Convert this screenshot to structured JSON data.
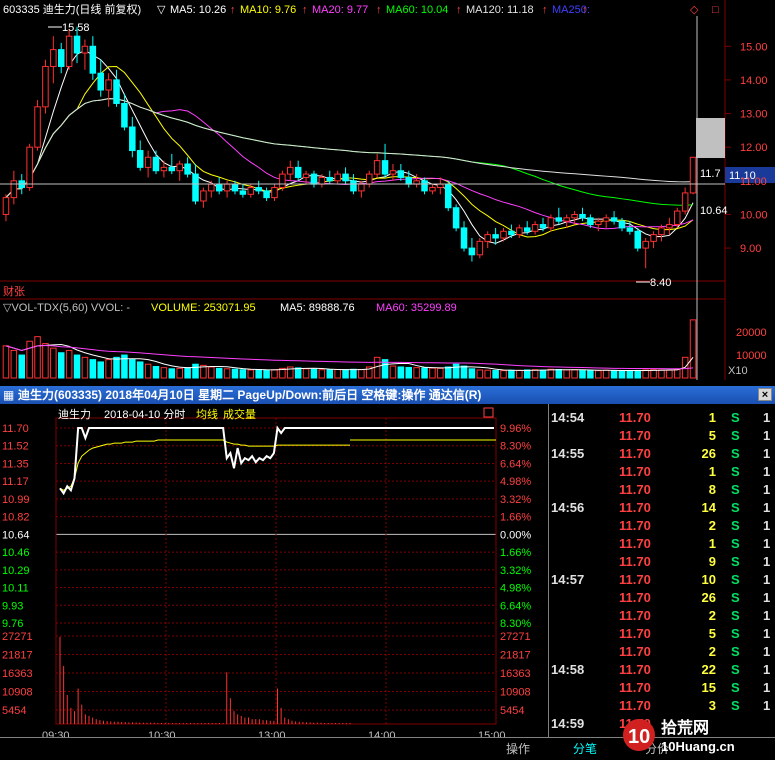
{
  "kline": {
    "title": "603335 迪生力(日线 前复权)",
    "ma_legend": [
      {
        "label": "MA5: 10.26",
        "color": "#ffffff"
      },
      {
        "label": "MA10: 9.76",
        "color": "#ffff00"
      },
      {
        "label": "MA20: 9.77",
        "color": "#ff40ff"
      },
      {
        "label": "MA60: 10.04",
        "color": "#00ff00"
      },
      {
        "label": "MA120: 11.18",
        "color": "#e0e0e0"
      },
      {
        "label": "MA250:",
        "color": "#4040ff"
      }
    ],
    "price_ticks": [
      "15.00",
      "14.00",
      "13.00",
      "12.00",
      "11.00",
      "10.00",
      "9.00"
    ],
    "current_price_box": "11.10",
    "annotations": {
      "high": "15.58",
      "low": "8.40",
      "right_a": "11.7",
      "right_b": "10.64"
    },
    "caizhang": "财张"
  },
  "volume": {
    "legend": "▽VOL-TDX(5,60)  VVOL: -",
    "volume_label": "VOLUME: 253071.95",
    "ma5_label": "MA5: 89888.76",
    "ma60_label": "MA60: 35299.89",
    "ticks": [
      "20000",
      "10000"
    ],
    "unit": "X10"
  },
  "popup": {
    "title": "迪生力(603335) 2018年04月10日 星期二 PageUp/Down:前后日 空格键:操作 通达信(R)",
    "close": "×",
    "chart_title": "迪生力",
    "chart_date": "2018-04-10 分时",
    "legend_avg": "均线",
    "legend_vol": "成交量",
    "price_left": [
      "11.70",
      "11.52",
      "11.35",
      "11.17",
      "10.99",
      "10.82",
      "10.64",
      "10.46",
      "10.29",
      "10.11",
      "9.93",
      "9.76"
    ],
    "pct_right": [
      "9.96%",
      "8.30%",
      "6.64%",
      "4.98%",
      "3.32%",
      "1.66%",
      "0.00%",
      "1.66%",
      "3.32%",
      "4.98%",
      "6.64%",
      "8.30%"
    ],
    "vol_left": [
      "27271",
      "21817",
      "16363",
      "10908",
      "5454"
    ],
    "vol_right": [
      "27271",
      "21817",
      "16363",
      "10908",
      "5454"
    ],
    "time_axis": [
      "09:30",
      "10:30",
      "13:00",
      "14:00",
      "15:00"
    ],
    "colors": {
      "up": "#ff3030",
      "down": "#00ffff",
      "flat": "#ffffff"
    }
  },
  "trades": [
    {
      "time": "14:54",
      "price": "11.70",
      "vol": "1",
      "side": "S",
      "n": "1"
    },
    {
      "time": "",
      "price": "11.70",
      "vol": "5",
      "side": "S",
      "n": "1"
    },
    {
      "time": "14:55",
      "price": "11.70",
      "vol": "26",
      "side": "S",
      "n": "1"
    },
    {
      "time": "",
      "price": "11.70",
      "vol": "1",
      "side": "S",
      "n": "1"
    },
    {
      "time": "",
      "price": "11.70",
      "vol": "8",
      "side": "S",
      "n": "1"
    },
    {
      "time": "14:56",
      "price": "11.70",
      "vol": "14",
      "side": "S",
      "n": "1"
    },
    {
      "time": "",
      "price": "11.70",
      "vol": "2",
      "side": "S",
      "n": "1"
    },
    {
      "time": "",
      "price": "11.70",
      "vol": "1",
      "side": "S",
      "n": "1"
    },
    {
      "time": "",
      "price": "11.70",
      "vol": "9",
      "side": "S",
      "n": "1"
    },
    {
      "time": "14:57",
      "price": "11.70",
      "vol": "10",
      "side": "S",
      "n": "1"
    },
    {
      "time": "",
      "price": "11.70",
      "vol": "26",
      "side": "S",
      "n": "1"
    },
    {
      "time": "",
      "price": "11.70",
      "vol": "2",
      "side": "S",
      "n": "1"
    },
    {
      "time": "",
      "price": "11.70",
      "vol": "5",
      "side": "S",
      "n": "1"
    },
    {
      "time": "",
      "price": "11.70",
      "vol": "2",
      "side": "S",
      "n": "1"
    },
    {
      "time": "14:58",
      "price": "11.70",
      "vol": "22",
      "side": "S",
      "n": "1"
    },
    {
      "time": "",
      "price": "11.70",
      "vol": "15",
      "side": "S",
      "n": "1"
    },
    {
      "time": "",
      "price": "11.70",
      "vol": "3",
      "side": "S",
      "n": "1"
    },
    {
      "time": "14:59",
      "price": "11.70",
      "vol": "",
      "side": "",
      "n": ""
    }
  ],
  "tabs": {
    "ops": "操作",
    "fenbi": "分笔",
    "fenjia": "分价"
  },
  "watermark": {
    "big": "拾荒网",
    "small": "10Huang.cn"
  },
  "chart_data": [
    {
      "type": "candlestick",
      "title": "603335 迪生力(日线 前复权)",
      "ylim": [
        8.2,
        15.9
      ],
      "annotations": {
        "high": 15.58,
        "low": 8.4
      },
      "candles": [
        [
          10.0,
          10.6,
          9.8,
          10.5
        ],
        [
          10.5,
          11.3,
          10.3,
          11.0
        ],
        [
          11.0,
          11.2,
          10.6,
          10.8
        ],
        [
          10.8,
          12.1,
          10.7,
          12.0
        ],
        [
          12.0,
          13.4,
          11.9,
          13.2
        ],
        [
          13.2,
          14.6,
          13.0,
          14.4
        ],
        [
          14.4,
          15.3,
          13.9,
          14.9
        ],
        [
          14.9,
          15.1,
          14.2,
          14.4
        ],
        [
          14.4,
          15.5,
          14.3,
          15.3
        ],
        [
          15.3,
          15.58,
          14.5,
          14.8
        ],
        [
          14.8,
          15.2,
          14.3,
          15.0
        ],
        [
          15.0,
          15.3,
          14.0,
          14.2
        ],
        [
          14.2,
          14.6,
          13.5,
          13.7
        ],
        [
          13.7,
          14.2,
          13.2,
          14.0
        ],
        [
          14.0,
          14.3,
          13.2,
          13.3
        ],
        [
          13.3,
          13.6,
          12.5,
          12.6
        ],
        [
          12.6,
          12.9,
          11.7,
          11.9
        ],
        [
          11.9,
          12.2,
          11.3,
          11.4
        ],
        [
          11.4,
          11.9,
          11.1,
          11.7
        ],
        [
          11.7,
          11.9,
          11.2,
          11.3
        ],
        [
          11.3,
          11.6,
          11.1,
          11.4
        ],
        [
          11.4,
          11.8,
          11.2,
          11.3
        ],
        [
          11.3,
          11.6,
          11.0,
          11.5
        ],
        [
          11.5,
          11.7,
          11.1,
          11.2
        ],
        [
          11.2,
          11.5,
          10.3,
          10.4
        ],
        [
          10.4,
          10.8,
          10.2,
          10.7
        ],
        [
          10.7,
          11.0,
          10.5,
          10.9
        ],
        [
          10.9,
          11.1,
          10.6,
          10.7
        ],
        [
          10.7,
          11.0,
          10.5,
          10.9
        ],
        [
          10.9,
          11.0,
          10.6,
          10.7
        ],
        [
          10.7,
          10.9,
          10.5,
          10.6
        ],
        [
          10.6,
          10.9,
          10.5,
          10.8
        ],
        [
          10.8,
          11.0,
          10.6,
          10.7
        ],
        [
          10.7,
          10.8,
          10.4,
          10.5
        ],
        [
          10.5,
          10.9,
          10.4,
          10.8
        ],
        [
          10.8,
          11.3,
          10.7,
          11.2
        ],
        [
          11.2,
          11.6,
          11.0,
          11.4
        ],
        [
          11.4,
          11.6,
          11.0,
          11.1
        ],
        [
          11.1,
          11.3,
          10.9,
          11.2
        ],
        [
          11.2,
          11.3,
          10.8,
          10.9
        ],
        [
          10.9,
          11.2,
          10.8,
          11.1
        ],
        [
          11.1,
          11.3,
          10.9,
          11.0
        ],
        [
          11.0,
          11.3,
          10.9,
          11.2
        ],
        [
          11.2,
          11.4,
          10.9,
          11.0
        ],
        [
          11.0,
          11.2,
          10.6,
          10.7
        ],
        [
          10.7,
          11.0,
          10.5,
          10.9
        ],
        [
          10.9,
          11.3,
          10.8,
          11.2
        ],
        [
          11.2,
          11.8,
          11.1,
          11.6
        ],
        [
          11.6,
          12.1,
          11.1,
          11.2
        ],
        [
          11.2,
          11.5,
          11.0,
          11.3
        ],
        [
          11.3,
          11.5,
          11.0,
          11.1
        ],
        [
          11.1,
          11.3,
          10.8,
          10.9
        ],
        [
          10.9,
          11.2,
          10.8,
          11.0
        ],
        [
          11.0,
          11.1,
          10.6,
          10.7
        ],
        [
          10.7,
          10.9,
          10.6,
          10.8
        ],
        [
          10.8,
          11.1,
          10.6,
          10.9
        ],
        [
          10.9,
          11.0,
          10.1,
          10.2
        ],
        [
          10.2,
          10.3,
          9.5,
          9.6
        ],
        [
          9.6,
          9.8,
          8.9,
          9.0
        ],
        [
          9.0,
          9.3,
          8.6,
          8.8
        ],
        [
          8.8,
          9.3,
          8.7,
          9.2
        ],
        [
          9.2,
          9.5,
          9.0,
          9.4
        ],
        [
          9.4,
          9.6,
          9.1,
          9.3
        ],
        [
          9.3,
          9.6,
          9.2,
          9.5
        ],
        [
          9.5,
          9.7,
          9.3,
          9.4
        ],
        [
          9.4,
          9.7,
          9.3,
          9.6
        ],
        [
          9.6,
          9.8,
          9.4,
          9.5
        ],
        [
          9.5,
          9.8,
          9.4,
          9.7
        ],
        [
          9.7,
          9.9,
          9.5,
          9.6
        ],
        [
          9.6,
          10.0,
          9.5,
          9.9
        ],
        [
          9.9,
          10.2,
          9.7,
          9.8
        ],
        [
          9.8,
          10.0,
          9.6,
          9.9
        ],
        [
          9.9,
          10.1,
          9.7,
          10.0
        ],
        [
          10.0,
          10.2,
          9.8,
          9.9
        ],
        [
          9.9,
          10.0,
          9.6,
          9.7
        ],
        [
          9.7,
          9.9,
          9.5,
          9.8
        ],
        [
          9.8,
          10.0,
          9.6,
          9.9
        ],
        [
          9.9,
          10.1,
          9.7,
          9.8
        ],
        [
          9.8,
          9.9,
          9.5,
          9.6
        ],
        [
          9.6,
          9.8,
          9.4,
          9.5
        ],
        [
          9.5,
          9.6,
          8.9,
          9.0
        ],
        [
          9.0,
          9.3,
          8.4,
          9.2
        ],
        [
          9.2,
          9.5,
          9.0,
          9.4
        ],
        [
          9.4,
          9.7,
          9.2,
          9.6
        ],
        [
          9.6,
          9.9,
          9.4,
          9.7
        ],
        [
          9.7,
          10.2,
          9.6,
          10.1
        ],
        [
          10.1,
          10.8,
          10.0,
          10.64
        ],
        [
          10.64,
          11.7,
          10.6,
          11.7
        ]
      ]
    },
    {
      "type": "bar",
      "title": "VOL-TDX(5,60)",
      "ylim": [
        0,
        27000
      ],
      "values": [
        14000,
        12000,
        10000,
        16000,
        18000,
        15000,
        13000,
        11000,
        12000,
        10000,
        9000,
        8000,
        7000,
        8000,
        9000,
        10000,
        8000,
        7000,
        6000,
        5000,
        4500,
        4000,
        4200,
        4500,
        6000,
        5500,
        4800,
        4200,
        4000,
        3800,
        3600,
        3500,
        3700,
        3400,
        3600,
        4200,
        4800,
        4400,
        4000,
        3800,
        3600,
        3500,
        3700,
        3600,
        3800,
        3700,
        4800,
        9000,
        8000,
        5200,
        4800,
        4600,
        4500,
        4400,
        4300,
        4200,
        4800,
        6000,
        5200,
        4000,
        3500,
        3400,
        3300,
        3200,
        3400,
        3300,
        3500,
        3600,
        3400,
        3800,
        3700,
        3500,
        3600,
        3400,
        3300,
        3200,
        3400,
        3300,
        3200,
        3100,
        3300,
        3500,
        3600,
        3500,
        3400,
        3800,
        9000,
        25307
      ]
    },
    {
      "type": "line",
      "title": "2018-04-10 分时",
      "ylim": [
        9.76,
        11.7
      ],
      "series": [
        {
          "name": "分时",
          "values": [
            11.1,
            11.05,
            11.12,
            11.08,
            11.2,
            11.7,
            11.7,
            11.6,
            11.7,
            11.7,
            11.7,
            11.7,
            11.7,
            11.7,
            11.7,
            11.7,
            11.7,
            11.7,
            11.7,
            11.7,
            11.7,
            11.7,
            11.7,
            11.7,
            11.7,
            11.7,
            11.7,
            11.7,
            11.7,
            11.7,
            11.7,
            11.7,
            11.7,
            11.7,
            11.7,
            11.7,
            11.7,
            11.7,
            11.7,
            11.7,
            11.7,
            11.7,
            11.7,
            11.7,
            11.7,
            11.7,
            11.4,
            11.45,
            11.3,
            11.5,
            11.35,
            11.4,
            11.38,
            11.42,
            11.36,
            11.4,
            11.38,
            11.42,
            11.4,
            11.45,
            11.7,
            11.65,
            11.7,
            11.7,
            11.7,
            11.7,
            11.7,
            11.7,
            11.7,
            11.7,
            11.7,
            11.7,
            11.7,
            11.7,
            11.7,
            11.7,
            11.7,
            11.7,
            11.7,
            11.7,
            11.7
          ]
        },
        {
          "name": "均线",
          "values": [
            11.1,
            11.08,
            11.1,
            11.12,
            11.2,
            11.35,
            11.42,
            11.45,
            11.48,
            11.5,
            11.51,
            11.52,
            11.53,
            11.54,
            11.54,
            11.55,
            11.55,
            11.55,
            11.56,
            11.56,
            11.56,
            11.57,
            11.57,
            11.57,
            11.57,
            11.57,
            11.57,
            11.58,
            11.58,
            11.58,
            11.58,
            11.58,
            11.58,
            11.58,
            11.58,
            11.58,
            11.58,
            11.58,
            11.58,
            11.58,
            11.58,
            11.58,
            11.58,
            11.58,
            11.58,
            11.58,
            11.56,
            11.55,
            11.54,
            11.54,
            11.53,
            11.53,
            11.52,
            11.52,
            11.52,
            11.52,
            11.52,
            11.52,
            11.52,
            11.52,
            11.53,
            11.53,
            11.53,
            11.53,
            11.53,
            11.53,
            11.53,
            11.53,
            11.53,
            11.53,
            11.53,
            11.53,
            11.53,
            11.53,
            11.53,
            11.53,
            11.53,
            11.53,
            11.53,
            11.53,
            11.53
          ]
        }
      ]
    },
    {
      "type": "bar",
      "title": "成交量",
      "ylim": [
        0,
        27271
      ],
      "values": [
        27000,
        18000,
        9000,
        5000,
        4000,
        11000,
        6000,
        3000,
        2500,
        2000,
        1500,
        1200,
        1000,
        900,
        800,
        700,
        700,
        600,
        600,
        500,
        500,
        500,
        400,
        400,
        400,
        400,
        400,
        300,
        300,
        300,
        300,
        300,
        300,
        300,
        300,
        300,
        300,
        300,
        300,
        300,
        300,
        300,
        300,
        300,
        300,
        300,
        16000,
        8000,
        4000,
        3000,
        2500,
        2000,
        2000,
        1500,
        1500,
        1500,
        1200,
        1200,
        1000,
        1000,
        11000,
        5000,
        2000,
        1500,
        1000,
        800,
        700,
        600,
        500,
        500,
        400,
        400,
        400,
        300,
        300,
        300,
        300,
        300,
        300,
        300,
        300
      ]
    }
  ]
}
